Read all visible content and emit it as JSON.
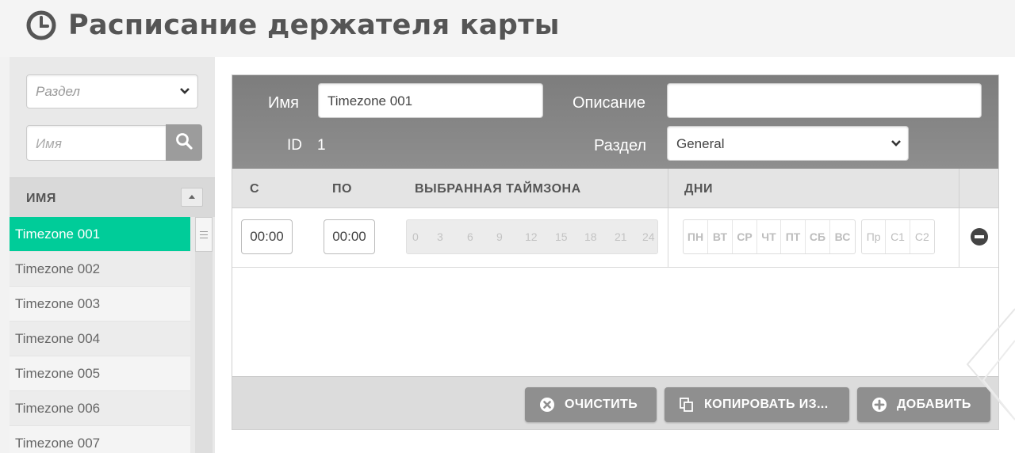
{
  "header": {
    "title": "Расписание держателя карты",
    "icon": "clock-icon"
  },
  "sidebar": {
    "section_select": {
      "placeholder": "Раздел"
    },
    "search": {
      "placeholder": "Имя",
      "icon": "search-icon"
    },
    "list_header": "ИМЯ",
    "items": [
      {
        "label": "Timezone 001",
        "selected": true
      },
      {
        "label": "Timezone 002"
      },
      {
        "label": "Timezone 003"
      },
      {
        "label": "Timezone 004"
      },
      {
        "label": "Timezone 005"
      },
      {
        "label": "Timezone 006"
      },
      {
        "label": "Timezone 007"
      }
    ]
  },
  "form": {
    "name_label": "Имя",
    "name_value": "Timezone 001",
    "description_label": "Описание",
    "description_value": "",
    "id_label": "ID",
    "id_value": "1",
    "section_label": "Раздел",
    "section_value": "General"
  },
  "table": {
    "columns": {
      "from": "С",
      "to": "ПО",
      "timezone": "ВЫБРАННАЯ ТАЙМЗОНА",
      "days": "ДНИ"
    },
    "rows": [
      {
        "from": "00:00",
        "to": "00:00",
        "ticks": [
          "0",
          "3",
          "6",
          "9",
          "12",
          "15",
          "18",
          "21",
          "24"
        ],
        "weekdays": [
          "ПН",
          "ВТ",
          "СР",
          "ЧТ",
          "ПТ",
          "СБ",
          "ВС"
        ],
        "special_days": [
          "Пр",
          "С1",
          "С2"
        ]
      }
    ]
  },
  "footer": {
    "clear_label": "ОЧИСТИТЬ",
    "copy_label": "КОПИРОВАТЬ ИЗ...",
    "add_label": "ДОБАВИТЬ"
  },
  "colors": {
    "accent": "#00cc99",
    "header_gray": "#868686",
    "button_gray": "#8f8f8f"
  }
}
